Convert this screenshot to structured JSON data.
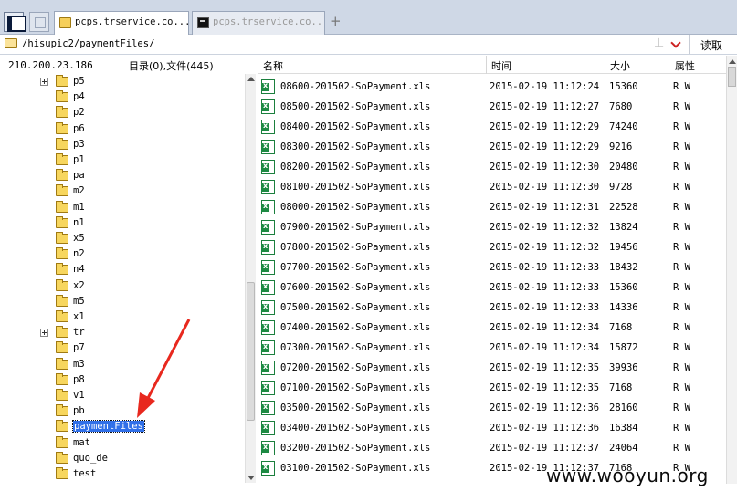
{
  "tabs": [
    {
      "label": "pcps.trservice.co...",
      "active": true,
      "icon": "folder-icon"
    },
    {
      "label": "pcps.trservice.co...",
      "active": false,
      "icon": "terminal-icon"
    }
  ],
  "toolbar": {
    "new_tab_label": "+",
    "extra_icon": "bookmark-icon"
  },
  "pathbar": {
    "path": "/hisupic2/paymentFiles/",
    "read_label": "读取"
  },
  "left_panel": {
    "host": "210.200.23.186",
    "summary": "目录(0),文件(445)",
    "tree": [
      {
        "label": "p5",
        "expandable": true
      },
      {
        "label": "p4",
        "expandable": false
      },
      {
        "label": "p2",
        "expandable": false
      },
      {
        "label": "p6",
        "expandable": false
      },
      {
        "label": "p3",
        "expandable": false
      },
      {
        "label": "p1",
        "expandable": false
      },
      {
        "label": "pa",
        "expandable": false
      },
      {
        "label": "m2",
        "expandable": false
      },
      {
        "label": "m1",
        "expandable": false
      },
      {
        "label": "n1",
        "expandable": false
      },
      {
        "label": "x5",
        "expandable": false
      },
      {
        "label": "n2",
        "expandable": false
      },
      {
        "label": "n4",
        "expandable": false
      },
      {
        "label": "x2",
        "expandable": false
      },
      {
        "label": "m5",
        "expandable": false
      },
      {
        "label": "x1",
        "expandable": false
      },
      {
        "label": "tr",
        "expandable": true
      },
      {
        "label": "p7",
        "expandable": false
      },
      {
        "label": "m3",
        "expandable": false
      },
      {
        "label": "p8",
        "expandable": false
      },
      {
        "label": "v1",
        "expandable": false
      },
      {
        "label": "pb",
        "expandable": false
      },
      {
        "label": "paymentFiles",
        "expandable": false,
        "selected": true
      },
      {
        "label": "mat",
        "expandable": false
      },
      {
        "label": "quo_de",
        "expandable": false
      },
      {
        "label": "test",
        "expandable": false
      }
    ]
  },
  "file_list": {
    "columns": {
      "name": "名称",
      "time": "时间",
      "size": "大小",
      "attr": "属性"
    },
    "rows": [
      {
        "name": "08600-201502-SoPayment.xls",
        "time": "2015-02-19  11:12:24",
        "size": "15360",
        "attr": "R W"
      },
      {
        "name": "08500-201502-SoPayment.xls",
        "time": "2015-02-19  11:12:27",
        "size": "7680",
        "attr": "R W"
      },
      {
        "name": "08400-201502-SoPayment.xls",
        "time": "2015-02-19  11:12:29",
        "size": "74240",
        "attr": "R W"
      },
      {
        "name": "08300-201502-SoPayment.xls",
        "time": "2015-02-19  11:12:29",
        "size": "9216",
        "attr": "R W"
      },
      {
        "name": "08200-201502-SoPayment.xls",
        "time": "2015-02-19  11:12:30",
        "size": "20480",
        "attr": "R W"
      },
      {
        "name": "08100-201502-SoPayment.xls",
        "time": "2015-02-19  11:12:30",
        "size": "9728",
        "attr": "R W"
      },
      {
        "name": "08000-201502-SoPayment.xls",
        "time": "2015-02-19  11:12:31",
        "size": "22528",
        "attr": "R W"
      },
      {
        "name": "07900-201502-SoPayment.xls",
        "time": "2015-02-19  11:12:32",
        "size": "13824",
        "attr": "R W"
      },
      {
        "name": "07800-201502-SoPayment.xls",
        "time": "2015-02-19  11:12:32",
        "size": "19456",
        "attr": "R W"
      },
      {
        "name": "07700-201502-SoPayment.xls",
        "time": "2015-02-19  11:12:33",
        "size": "18432",
        "attr": "R W"
      },
      {
        "name": "07600-201502-SoPayment.xls",
        "time": "2015-02-19  11:12:33",
        "size": "15360",
        "attr": "R W"
      },
      {
        "name": "07500-201502-SoPayment.xls",
        "time": "2015-02-19  11:12:33",
        "size": "14336",
        "attr": "R W"
      },
      {
        "name": "07400-201502-SoPayment.xls",
        "time": "2015-02-19  11:12:34",
        "size": "7168",
        "attr": "R W"
      },
      {
        "name": "07300-201502-SoPayment.xls",
        "time": "2015-02-19  11:12:34",
        "size": "15872",
        "attr": "R W"
      },
      {
        "name": "07200-201502-SoPayment.xls",
        "time": "2015-02-19  11:12:35",
        "size": "39936",
        "attr": "R W"
      },
      {
        "name": "07100-201502-SoPayment.xls",
        "time": "2015-02-19  11:12:35",
        "size": "7168",
        "attr": "R W"
      },
      {
        "name": "03500-201502-SoPayment.xls",
        "time": "2015-02-19  11:12:36",
        "size": "28160",
        "attr": "R W"
      },
      {
        "name": "03400-201502-SoPayment.xls",
        "time": "2015-02-19  11:12:36",
        "size": "16384",
        "attr": "R W"
      },
      {
        "name": "03200-201502-SoPayment.xls",
        "time": "2015-02-19  11:12:37",
        "size": "24064",
        "attr": "R W"
      },
      {
        "name": "03100-201502-SoPayment.xls",
        "time": "2015-02-19  11:12:37",
        "size": "7168",
        "attr": "R W"
      }
    ]
  },
  "watermark": "www.wooyun.org",
  "colors": {
    "selection": "#3170e8",
    "annotation_arrow": "#e8281e",
    "tab_bar": "#cfd8e6"
  }
}
